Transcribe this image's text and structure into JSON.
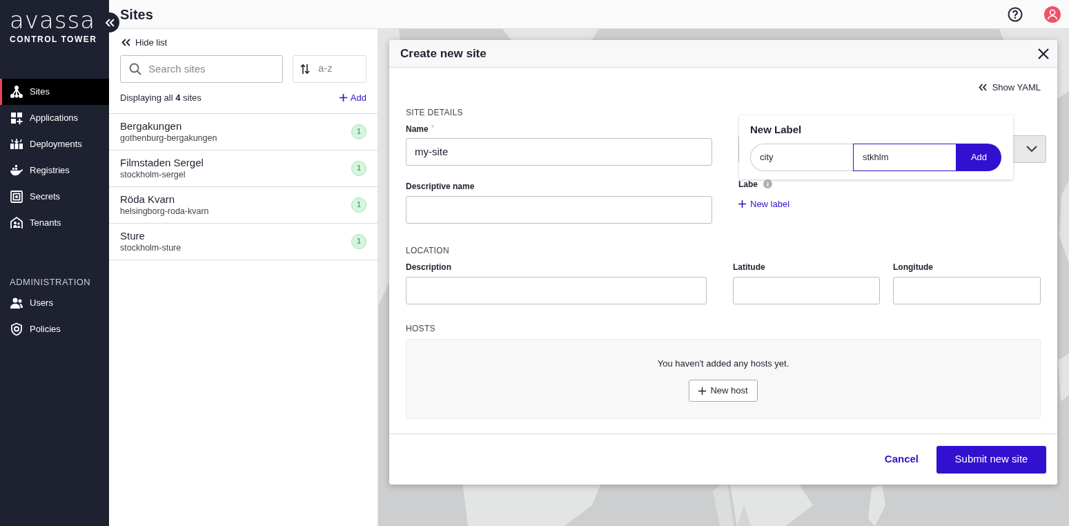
{
  "brand": {
    "logo": "avassa",
    "subtitle": "CONTROL TOWER"
  },
  "sidebar": {
    "items": [
      {
        "label": "Sites",
        "kind": "sites",
        "selected": true
      },
      {
        "label": "Applications",
        "kind": "applications",
        "selected": false
      },
      {
        "label": "Deployments",
        "kind": "deployments",
        "selected": false
      },
      {
        "label": "Registries",
        "kind": "registries",
        "selected": false
      },
      {
        "label": "Secrets",
        "kind": "secrets",
        "selected": false
      },
      {
        "label": "Tenants",
        "kind": "tenants",
        "selected": false
      }
    ],
    "section": "ADMINISTRATION",
    "admin_items": [
      {
        "label": "Users",
        "kind": "users",
        "selected": false
      },
      {
        "label": "Policies",
        "kind": "policies",
        "selected": false
      }
    ]
  },
  "page_title": "Sites",
  "list": {
    "hide": "Hide list",
    "search": {
      "placeholder": "Search sites"
    },
    "sort": "a-z",
    "summary": "Displaying all **4** sites",
    "add": "Add",
    "sites": [
      {
        "name": "Bergakungen",
        "slug": "gothenburg-bergakungen",
        "count": "1"
      },
      {
        "name": "Filmstaden Sergel",
        "slug": "stockholm-sergel",
        "count": "1"
      },
      {
        "name": "Röda Kvarn",
        "slug": "helsingborg-roda-kvarn",
        "count": "1"
      },
      {
        "name": "Sture",
        "slug": "stockholm-sture",
        "count": "1"
      }
    ]
  },
  "modal": {
    "title": "Create new site",
    "show_yaml": "Show YAML",
    "site_details": "SITE DETAILS",
    "name": {
      "label": "Name",
      "required": "*",
      "value": "my-site"
    },
    "descriptive_name": {
      "label": "Descriptive name"
    },
    "labels": {
      "label": "Labe",
      "add": "New label"
    },
    "location": "LOCATION",
    "description": {
      "label": "Description"
    },
    "latitude": {
      "label": "Latitude"
    },
    "longitude": {
      "label": "Longitude"
    },
    "hosts": "HOSTS",
    "hosts_empty": "You haven't added any hosts yet.",
    "new_host": "New host",
    "cancel": "Cancel",
    "submit": "Submit new site"
  },
  "popover": {
    "title": "New Label",
    "key": "city",
    "value": "stkhlm",
    "add": "Add"
  }
}
